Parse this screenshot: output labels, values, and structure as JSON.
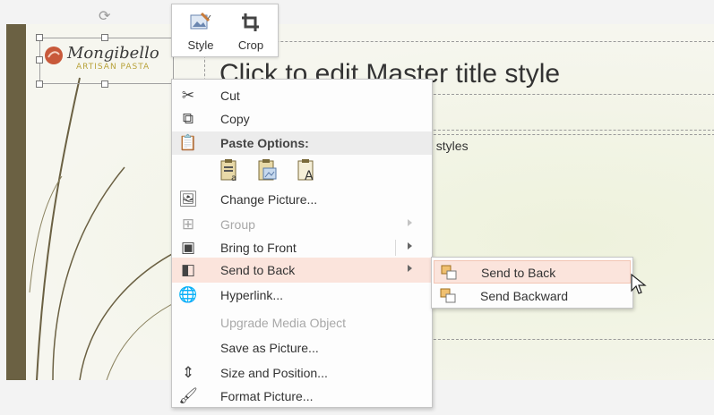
{
  "slide": {
    "title_placeholder": "Click to edit Master title style",
    "body_placeholder": "xt styles",
    "logo": {
      "name": "Mongibello",
      "tagline": "ARTISAN PASTA"
    }
  },
  "mini_toolbar": {
    "style_label": "Style",
    "crop_label": "Crop"
  },
  "context_menu": {
    "cut": "Cut",
    "copy": "Copy",
    "paste_options_header": "Paste Options:",
    "change_picture": "Change Picture...",
    "group": "Group",
    "bring_to_front": "Bring to Front",
    "send_to_back": "Send to Back",
    "hyperlink": "Hyperlink...",
    "upgrade_media_object": "Upgrade Media Object",
    "save_as_picture": "Save as Picture...",
    "size_and_position": "Size and Position...",
    "format_picture": "Format Picture..."
  },
  "submenu": {
    "send_to_back": "Send to Back",
    "send_backward": "Send Backward"
  },
  "colors": {
    "hover_bg": "#fbe4dc",
    "slide_bar": "#6b6143",
    "logo_accent": "#b8a23a",
    "logo_mark": "#c8593a"
  },
  "icons": {
    "cut": "scissors-icon",
    "copy": "copy-icon",
    "paste": "paste-icon",
    "change_picture": "change-picture-icon",
    "group": "group-icon",
    "bring_to_front": "bring-to-front-icon",
    "send_to_back": "send-to-back-icon",
    "hyperlink": "globe-link-icon",
    "size_and_position": "size-position-icon",
    "format_picture": "format-picture-icon"
  }
}
